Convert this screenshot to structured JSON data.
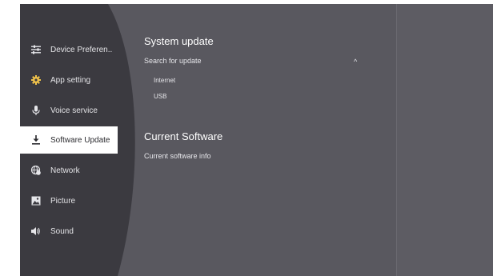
{
  "sidebar": {
    "items": [
      {
        "label": "Device Preferen..",
        "icon": "sliders-icon"
      },
      {
        "label": "App setting",
        "icon": "gear-icon"
      },
      {
        "label": "Voice service",
        "icon": "microphone-icon"
      },
      {
        "label": "Software Update",
        "icon": "download-icon",
        "active": true
      },
      {
        "label": "Network",
        "icon": "globe-icon"
      },
      {
        "label": "Picture",
        "icon": "picture-icon"
      },
      {
        "label": "Sound",
        "icon": "speaker-icon"
      }
    ]
  },
  "main": {
    "system_update": {
      "title": "System update",
      "search_label": "Search for update",
      "expand_glyph": "^",
      "options": [
        "Internet",
        "USB"
      ]
    },
    "current_software": {
      "title": "Current Software",
      "info_label": "Current software info"
    }
  },
  "colors": {
    "screen_bg": "#59585f",
    "sidebar_bg": "#3b3a40",
    "active_bg": "#ffffff",
    "text": "#e6e6ea"
  }
}
